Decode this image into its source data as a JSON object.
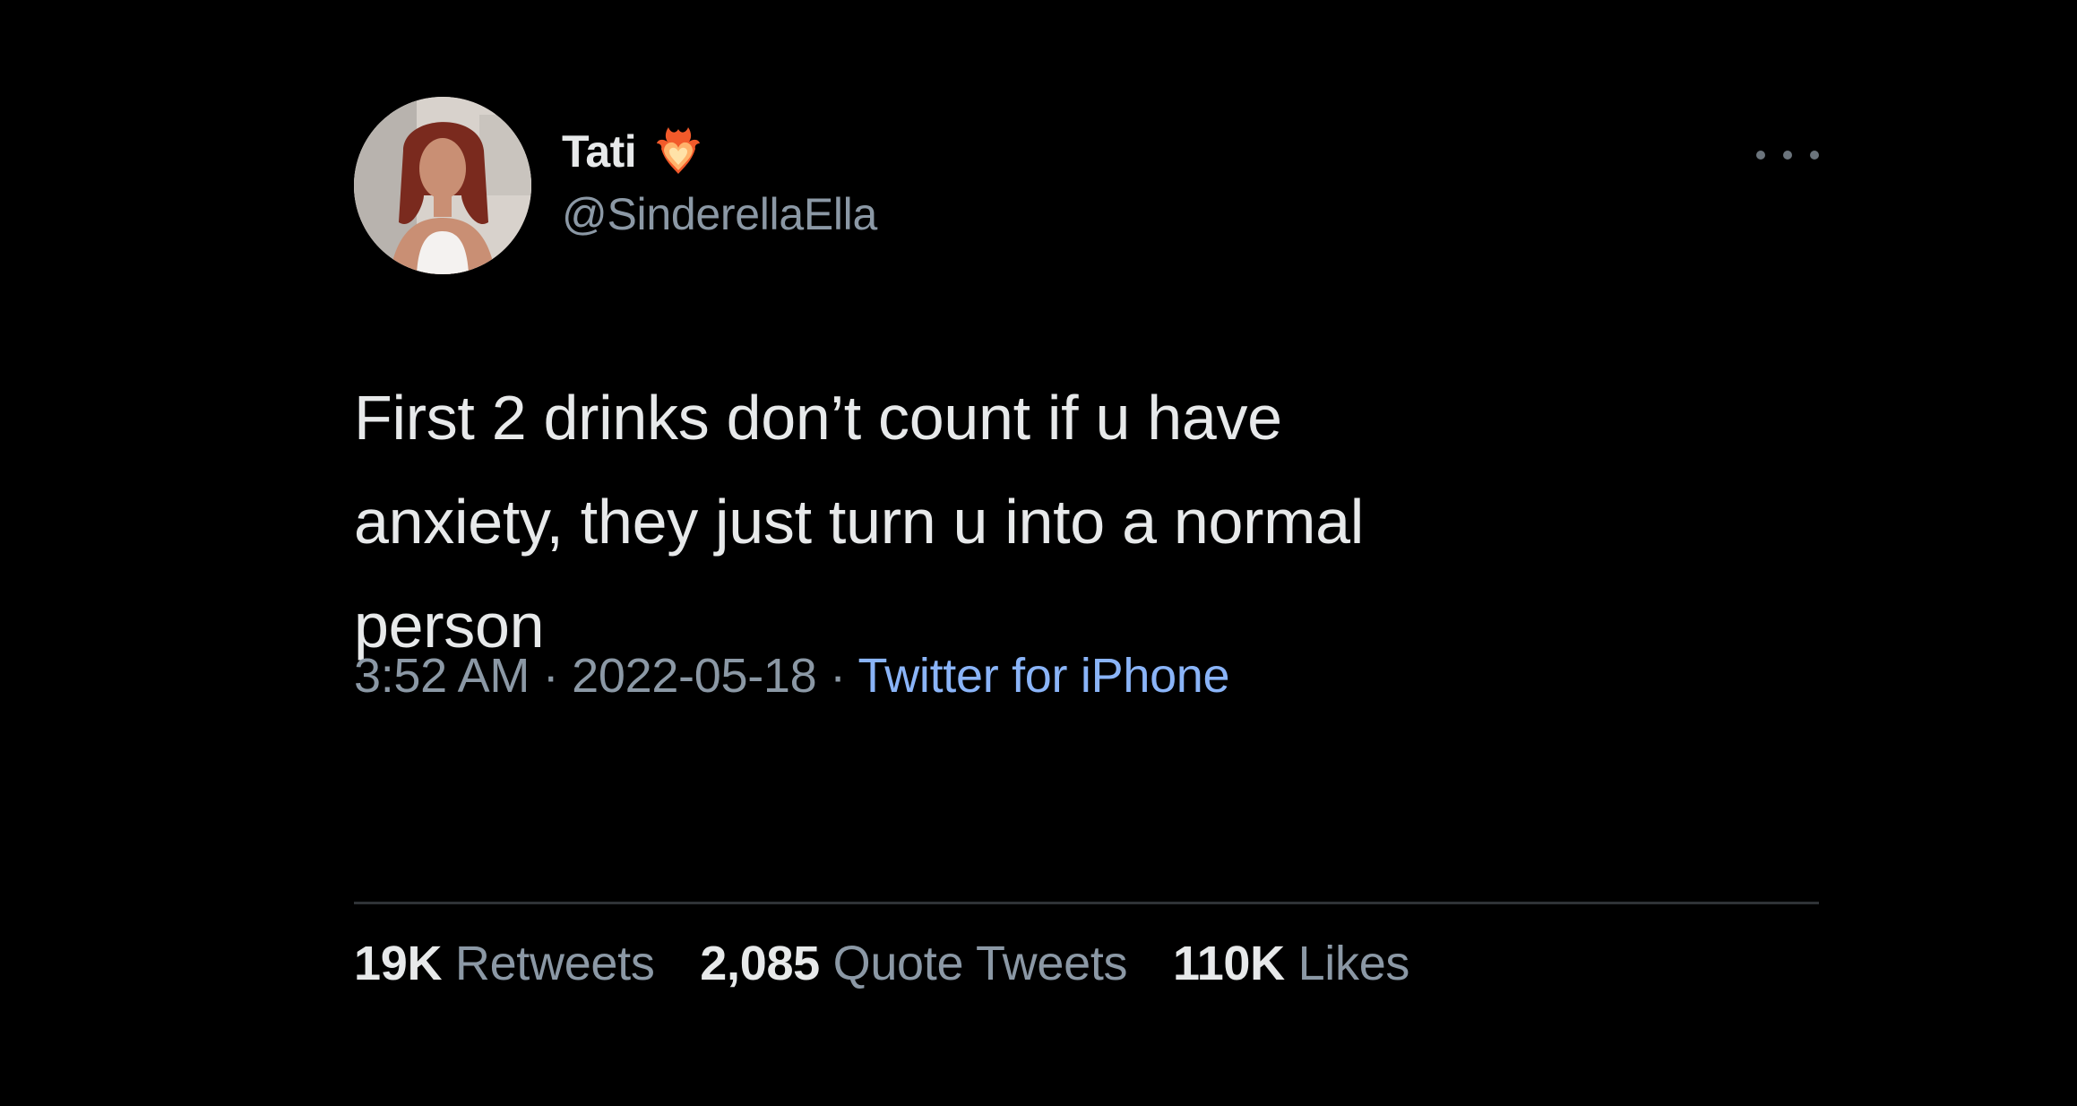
{
  "tweet": {
    "display_name": "Tati",
    "handle": "@SinderellaElla",
    "badge_icon": "flaming-heart-icon",
    "more_icon": "more-options-icon",
    "text_lines": [
      "First 2 drinks don’t count if u have",
      "anxiety, they just turn u into a normal",
      "person"
    ],
    "time": "3:52 AM",
    "separator": "·",
    "date": "2022-05-18",
    "source": "Twitter for iPhone",
    "stats": {
      "retweets_count": "19K",
      "retweets_label": "Retweets",
      "quotes_count": "2,085",
      "quotes_label": "Quote Tweets",
      "likes_count": "110K",
      "likes_label": "Likes"
    }
  },
  "colors": {
    "background": "#000000",
    "primary_text": "#e7e9ea",
    "secondary_text": "#8b98a5",
    "link": "#8ab4f8",
    "divider": "#2f3336"
  }
}
